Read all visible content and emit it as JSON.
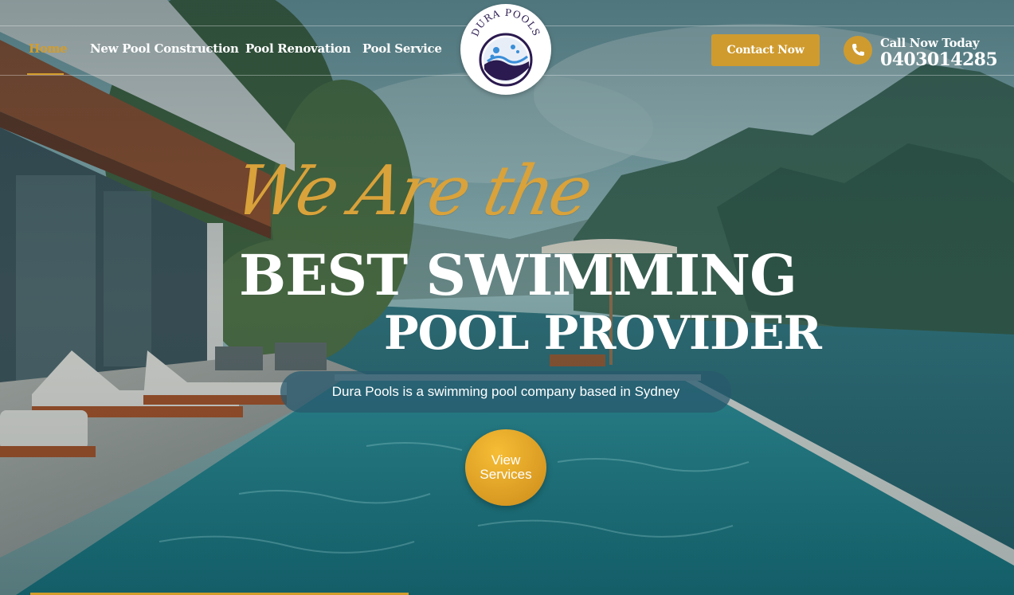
{
  "nav": {
    "items": [
      {
        "label": "Home",
        "active": true
      },
      {
        "label": "New Pool Construction",
        "active": false
      },
      {
        "label": "Pool Renovation",
        "active": false
      },
      {
        "label": "Pool Service",
        "active": false
      }
    ]
  },
  "logo": {
    "text": "DURA POOLS"
  },
  "header": {
    "contact_label": "Contact Now",
    "call_label": "Call Now Today",
    "phone": "0403014285"
  },
  "hero": {
    "script_title": "We Are the",
    "title_line1": "BEST SWIMMING",
    "title_line2": "POOL PROVIDER",
    "tagline": "Dura Pools is a swimming pool company based in Sydney",
    "cta_line1": "View",
    "cta_line2": "Services"
  },
  "colors": {
    "accent": "#cf9b2e",
    "nav_active": "#d39d2b",
    "text": "#ffffff"
  },
  "icons": [
    "phone-icon",
    "logo-bubbles-icon"
  ]
}
